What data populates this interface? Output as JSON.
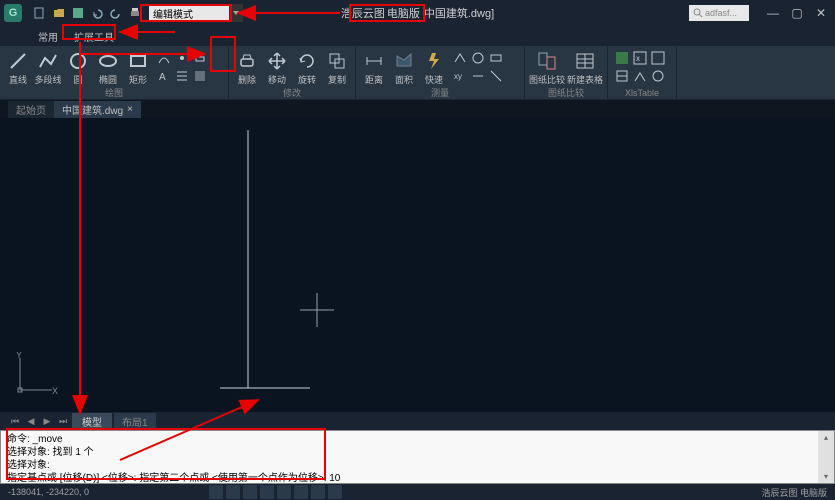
{
  "title": {
    "brand": "浩辰云图",
    "version": "电脑版",
    "file": "中国建筑.dwg]"
  },
  "search_placeholder": "adfasf...",
  "mode_label": "编辑模式",
  "tabs": {
    "common": "常用",
    "ext": "扩展工具"
  },
  "ribbon": {
    "draw": {
      "name": "绘图",
      "line": "直线",
      "pline": "多段线",
      "circle": "圆",
      "ellipse": "椭圆",
      "rect": "矩形"
    },
    "modify": {
      "name": "修改",
      "erase": "删除",
      "move": "移动",
      "rotate": "旋转",
      "copy": "复制"
    },
    "measure": {
      "name": "测量",
      "dist": "距离",
      "area": "面积",
      "quick": "快速"
    },
    "compare": {
      "name": "图纸比较",
      "dwg": "图纸比较",
      "tbl": "新建表格",
      "xls": "XlsTable"
    }
  },
  "doctabs": {
    "start": "起始页",
    "file": "中国建筑.dwg"
  },
  "modeltab": "模型",
  "layout": "布局1",
  "cmd": {
    "l1": "命令: _move",
    "l2": "选择对象: 找到 1 个",
    "l3": "选择对象:",
    "l4": "指定基点或 [位移(D)] <位移>:   指定第二个点或 <使用第一个点作为位移>: 10"
  },
  "status": {
    "coords": "-138041, -234220, 0",
    "right": "浩辰云图 电脑版"
  }
}
